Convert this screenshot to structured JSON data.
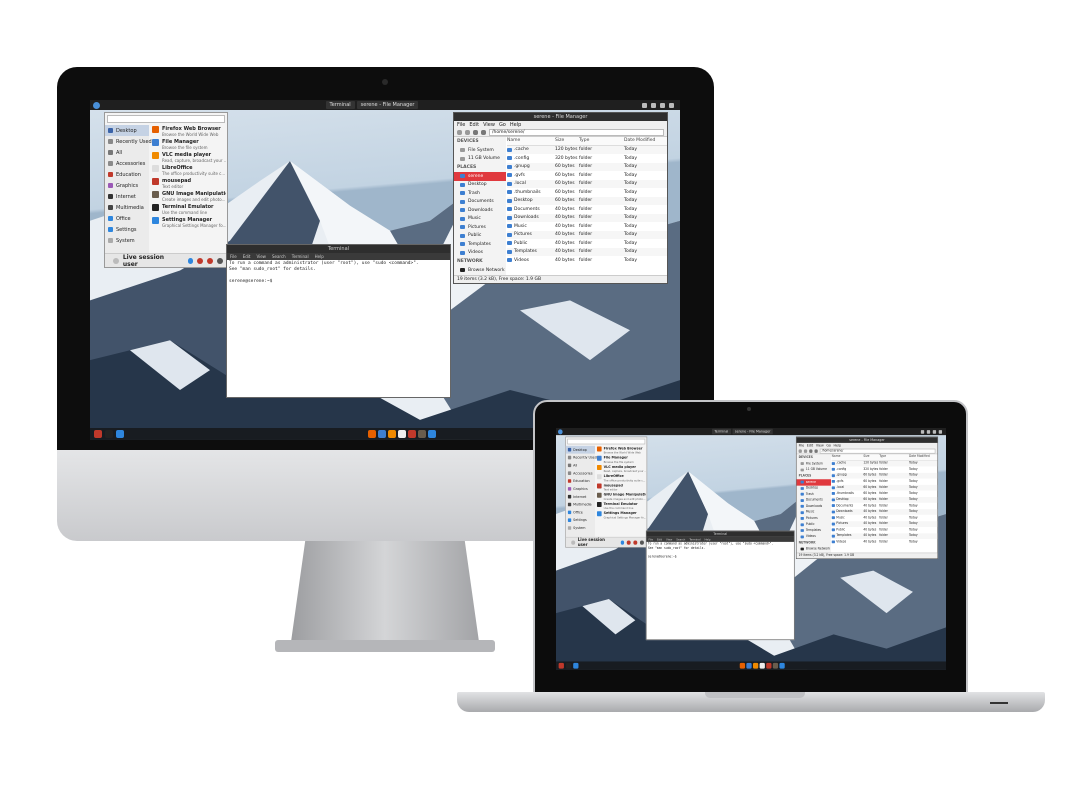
{
  "panel": {
    "tasks": [
      "Terminal",
      "serene - File Manager"
    ]
  },
  "app_menu": {
    "categories": [
      {
        "label": "Desktop",
        "color": "#3a63a8",
        "selected": true
      },
      {
        "label": "Recently Used",
        "color": "#888888"
      },
      {
        "label": "All",
        "color": "#777777"
      },
      {
        "label": "Accessories",
        "color": "#8a8a8a"
      },
      {
        "label": "Education",
        "color": "#c0392b"
      },
      {
        "label": "Graphics",
        "color": "#9b59b6"
      },
      {
        "label": "Internet",
        "color": "#333333"
      },
      {
        "label": "Multimedia",
        "color": "#444444"
      },
      {
        "label": "Office",
        "color": "#2e86de"
      },
      {
        "label": "Settings",
        "color": "#2e86de"
      },
      {
        "label": "System",
        "color": "#aaaaaa"
      }
    ],
    "apps": [
      {
        "name": "Firefox Web Browser",
        "desc": "Browse the World Wide Web",
        "color": "#e66000"
      },
      {
        "name": "File Manager",
        "desc": "Browse the file system",
        "color": "#3d7fd1"
      },
      {
        "name": "VLC media player",
        "desc": "Read, capture, broadcast your ...",
        "color": "#f08a00"
      },
      {
        "name": "LibreOffice",
        "desc": "The office productivity suite c...",
        "color": "#dddddd"
      },
      {
        "name": "mousepad",
        "desc": "Text editor",
        "color": "#c0392b"
      },
      {
        "name": "GNU Image Manipulation ...",
        "desc": "Create images and edit photo...",
        "color": "#6a5d4d"
      },
      {
        "name": "Terminal Emulator",
        "desc": "Use the command line",
        "color": "#222222"
      },
      {
        "name": "Settings Manager",
        "desc": "Graphical Settings Manager fo...",
        "color": "#2e86de"
      }
    ],
    "session_label": "Live session user"
  },
  "terminal": {
    "title": "Terminal",
    "menu": [
      "File",
      "Edit",
      "View",
      "Search",
      "Terminal",
      "Help"
    ],
    "lines": [
      "To run a command as administrator (user \"root\"), use \"sudo <command>\".",
      "See \"man sudo_root\" for details.",
      "",
      "serene@serene:~$ "
    ]
  },
  "file_manager": {
    "title": "serene - File Manager",
    "menu": [
      "File",
      "Edit",
      "View",
      "Go",
      "Help"
    ],
    "path": "/home/serene/",
    "sections": {
      "devices": "DEVICES",
      "places": "PLACES",
      "network": "NETWORK"
    },
    "devices": [
      "File System",
      "11 GB Volume"
    ],
    "places": [
      "serene",
      "Desktop",
      "Trash",
      "Documents",
      "Downloads",
      "Music",
      "Pictures",
      "Public",
      "Templates",
      "Videos"
    ],
    "network": [
      "Browse Network"
    ],
    "columns": [
      "Name",
      "Size",
      "Type",
      "Date Modified"
    ],
    "rows": [
      {
        "name": ".cache",
        "size": "120 bytes",
        "type": "folder",
        "date": "Today"
      },
      {
        "name": ".config",
        "size": "320 bytes",
        "type": "folder",
        "date": "Today"
      },
      {
        "name": ".gnupg",
        "size": "60 bytes",
        "type": "folder",
        "date": "Today"
      },
      {
        "name": ".gvfs",
        "size": "60 bytes",
        "type": "folder",
        "date": "Today"
      },
      {
        "name": ".local",
        "size": "60 bytes",
        "type": "folder",
        "date": "Today"
      },
      {
        "name": ".thumbnails",
        "size": "60 bytes",
        "type": "folder",
        "date": "Today"
      },
      {
        "name": "Desktop",
        "size": "60 bytes",
        "type": "folder",
        "date": "Today"
      },
      {
        "name": "Documents",
        "size": "40 bytes",
        "type": "folder",
        "date": "Today"
      },
      {
        "name": "Downloads",
        "size": "40 bytes",
        "type": "folder",
        "date": "Today"
      },
      {
        "name": "Music",
        "size": "40 bytes",
        "type": "folder",
        "date": "Today"
      },
      {
        "name": "Pictures",
        "size": "40 bytes",
        "type": "folder",
        "date": "Today"
      },
      {
        "name": "Public",
        "size": "40 bytes",
        "type": "folder",
        "date": "Today"
      },
      {
        "name": "Templates",
        "size": "40 bytes",
        "type": "folder",
        "date": "Today"
      },
      {
        "name": "Videos",
        "size": "40 bytes",
        "type": "folder",
        "date": "Today"
      }
    ],
    "status": "19 items (3.2 kB), Free space: 1.9 GB"
  },
  "dock": {
    "left_icons": [
      "power-icon",
      "terminal-icon",
      "settings-icon"
    ],
    "apps": [
      {
        "icon": "firefox-icon",
        "color": "#e66000"
      },
      {
        "icon": "files-icon",
        "color": "#3d7fd1"
      },
      {
        "icon": "vlc-icon",
        "color": "#f08a00"
      },
      {
        "icon": "libreoffice-icon",
        "color": "#eeeeee"
      },
      {
        "icon": "text-editor-icon",
        "color": "#c0392b"
      },
      {
        "icon": "gimp-icon",
        "color": "#6a5d4d"
      },
      {
        "icon": "settings-icon",
        "color": "#2e86de"
      }
    ]
  }
}
